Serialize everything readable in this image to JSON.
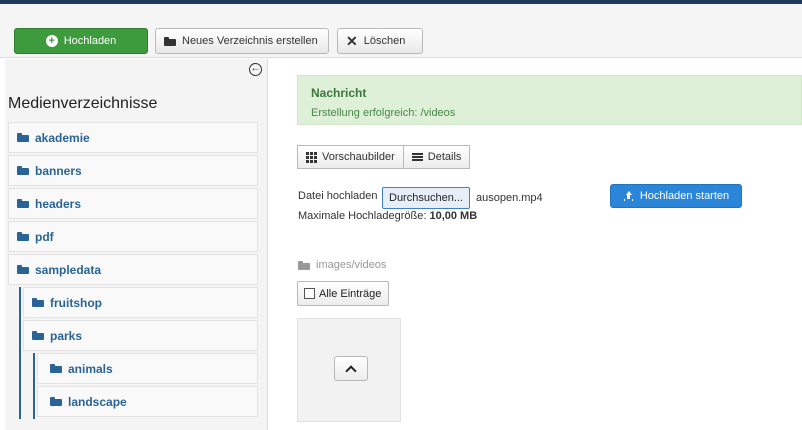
{
  "toolbar": {
    "upload_label": "Hochladen",
    "new_folder_label": "Neues Verzeichnis erstellen",
    "delete_label": "Löschen"
  },
  "sidebar": {
    "title": "Medienverzeichnisse",
    "items": [
      {
        "label": "akademie",
        "level": 0
      },
      {
        "label": "banners",
        "level": 0
      },
      {
        "label": "headers",
        "level": 0
      },
      {
        "label": "pdf",
        "level": 0
      },
      {
        "label": "sampledata",
        "level": 0
      },
      {
        "label": "fruitshop",
        "level": 1
      },
      {
        "label": "parks",
        "level": 1
      },
      {
        "label": "animals",
        "level": 2
      },
      {
        "label": "landscape",
        "level": 2
      }
    ]
  },
  "message": {
    "title": "Nachricht",
    "text": "Erstellung erfolgreich: /videos"
  },
  "view": {
    "thumbnails_label": "Vorschaubilder",
    "details_label": "Details"
  },
  "upload": {
    "label": "Datei hochladen",
    "browse_label": "Durchsuchen...",
    "file_name": "ausopen.mp4",
    "start_label": "Hochladen starten",
    "max_size_label": "Maximale Hochladegröße:",
    "max_size_value": "10,00 MB"
  },
  "path": "images/videos",
  "select_all_label": "Alle Einträge",
  "colors": {
    "accent_blue": "#2b86d9",
    "success_green": "#3d9a3d",
    "alert_bg": "#dff0d8",
    "folder_link": "#2a6496"
  }
}
